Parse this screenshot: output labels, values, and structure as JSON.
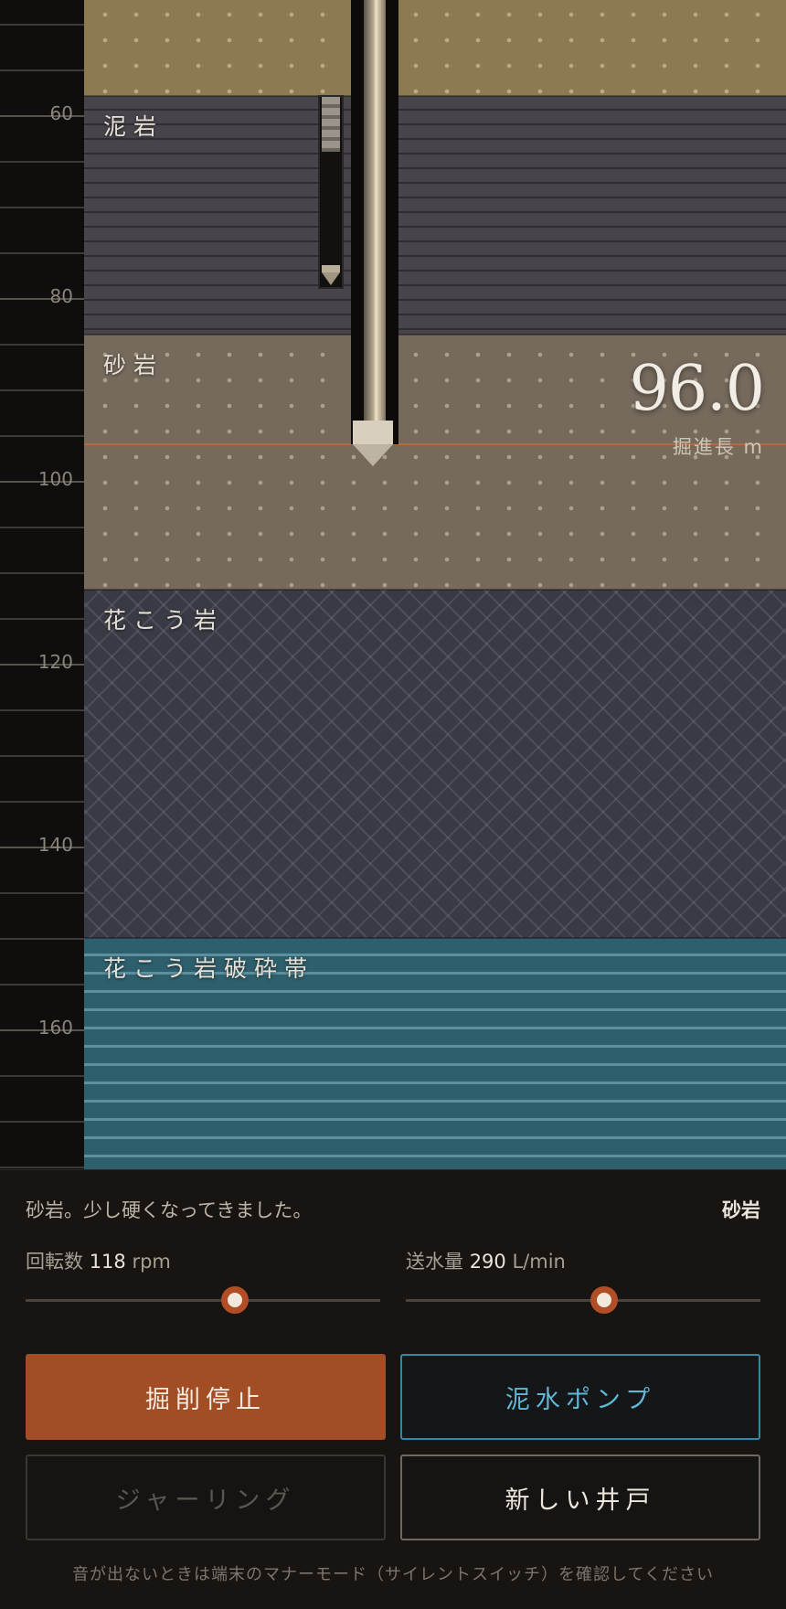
{
  "ruler": {
    "major_labels": [
      "60",
      "80",
      "100",
      "120",
      "140",
      "160"
    ]
  },
  "layers": [
    {
      "name": ""
    },
    {
      "name": "泥岩"
    },
    {
      "name": "砂岩"
    },
    {
      "name": "花こう岩"
    },
    {
      "name": "花こう岩破砕帯"
    }
  ],
  "readout": {
    "depth_value": "96.0",
    "depth_caption": "掘進長 m"
  },
  "panel": {
    "message": "砂岩。少し硬くなってきました。",
    "current_layer": "砂岩",
    "rpm": {
      "label": "回転数",
      "value": "118",
      "unit": "rpm",
      "fraction": 0.59
    },
    "flow": {
      "label": "送水量",
      "value": "290",
      "unit": "L/min",
      "fraction": 0.56
    },
    "buttons": {
      "stop": "掘削停止",
      "pump": "泥水ポンプ",
      "jar": "ジャーリング",
      "new_well": "新しい井戸"
    },
    "hint": "音が出ないときは端末のマナーモード（サイレントスイッチ）を確認してください"
  },
  "colors": {
    "accent": "#a24d23",
    "pump": "#2f8aa8",
    "depth_line": "#c06b3c"
  },
  "icons": [
    "drill-bit-icon",
    "drill-gauge-icon"
  ]
}
